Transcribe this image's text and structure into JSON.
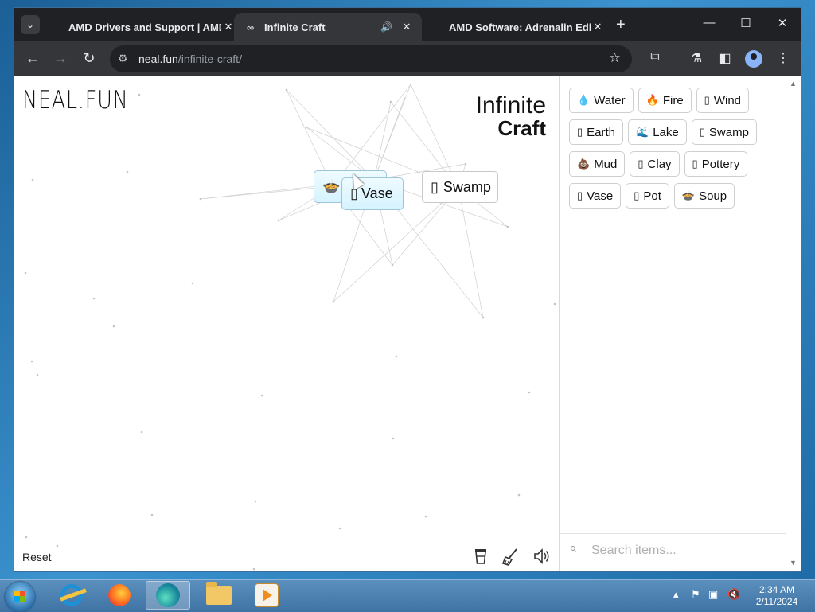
{
  "browser": {
    "tab_dropdown_icon": "chevron-down-icon",
    "tabs": [
      {
        "title": "AMD Drivers and Support | AMD",
        "close": "✕"
      },
      {
        "title": "Infinite Craft",
        "audio": "🔊",
        "close": "✕"
      },
      {
        "title": "AMD Software: Adrenalin Edition",
        "close": "✕"
      }
    ],
    "new_tab_symbol": "+",
    "window_controls": {
      "minimize": "—",
      "maximize": "☐",
      "close": "✕"
    },
    "url_host": "neal.fun",
    "url_path": "/infinite-craft/"
  },
  "app": {
    "brand": "NEAL.FUN",
    "title_line1": "Infinite",
    "title_line2": "Craft",
    "reset_label": "Reset",
    "canvas_items": [
      {
        "emoji": "🍲",
        "label": ""
      },
      {
        "emoji": "▯",
        "label": "Vase"
      },
      {
        "emoji": "▯",
        "label": "Swamp"
      }
    ],
    "bottom_icons": [
      "cup-icon",
      "broom-icon",
      "sound-icon"
    ],
    "sidebar_items": [
      {
        "emoji": "💧",
        "label": "Water"
      },
      {
        "emoji": "🔥",
        "label": "Fire"
      },
      {
        "emoji": "▯",
        "label": "Wind"
      },
      {
        "emoji": "▯",
        "label": "Earth"
      },
      {
        "emoji": "🌊",
        "label": "Lake"
      },
      {
        "emoji": "▯",
        "label": "Swamp"
      },
      {
        "emoji": "💩",
        "label": "Mud"
      },
      {
        "emoji": "▯",
        "label": "Clay"
      },
      {
        "emoji": "▯",
        "label": "Pottery"
      },
      {
        "emoji": "▯",
        "label": "Vase"
      },
      {
        "emoji": "▯",
        "label": "Pot"
      },
      {
        "emoji": "🍲",
        "label": "Soup"
      }
    ],
    "search_placeholder": "Search items..."
  },
  "taskbar": {
    "apps": [
      "internet-explorer",
      "firefox",
      "edge",
      "file-explorer",
      "media-player"
    ],
    "active_app": "edge",
    "clock_time": "2:34 AM",
    "clock_date": "2/11/2024"
  }
}
